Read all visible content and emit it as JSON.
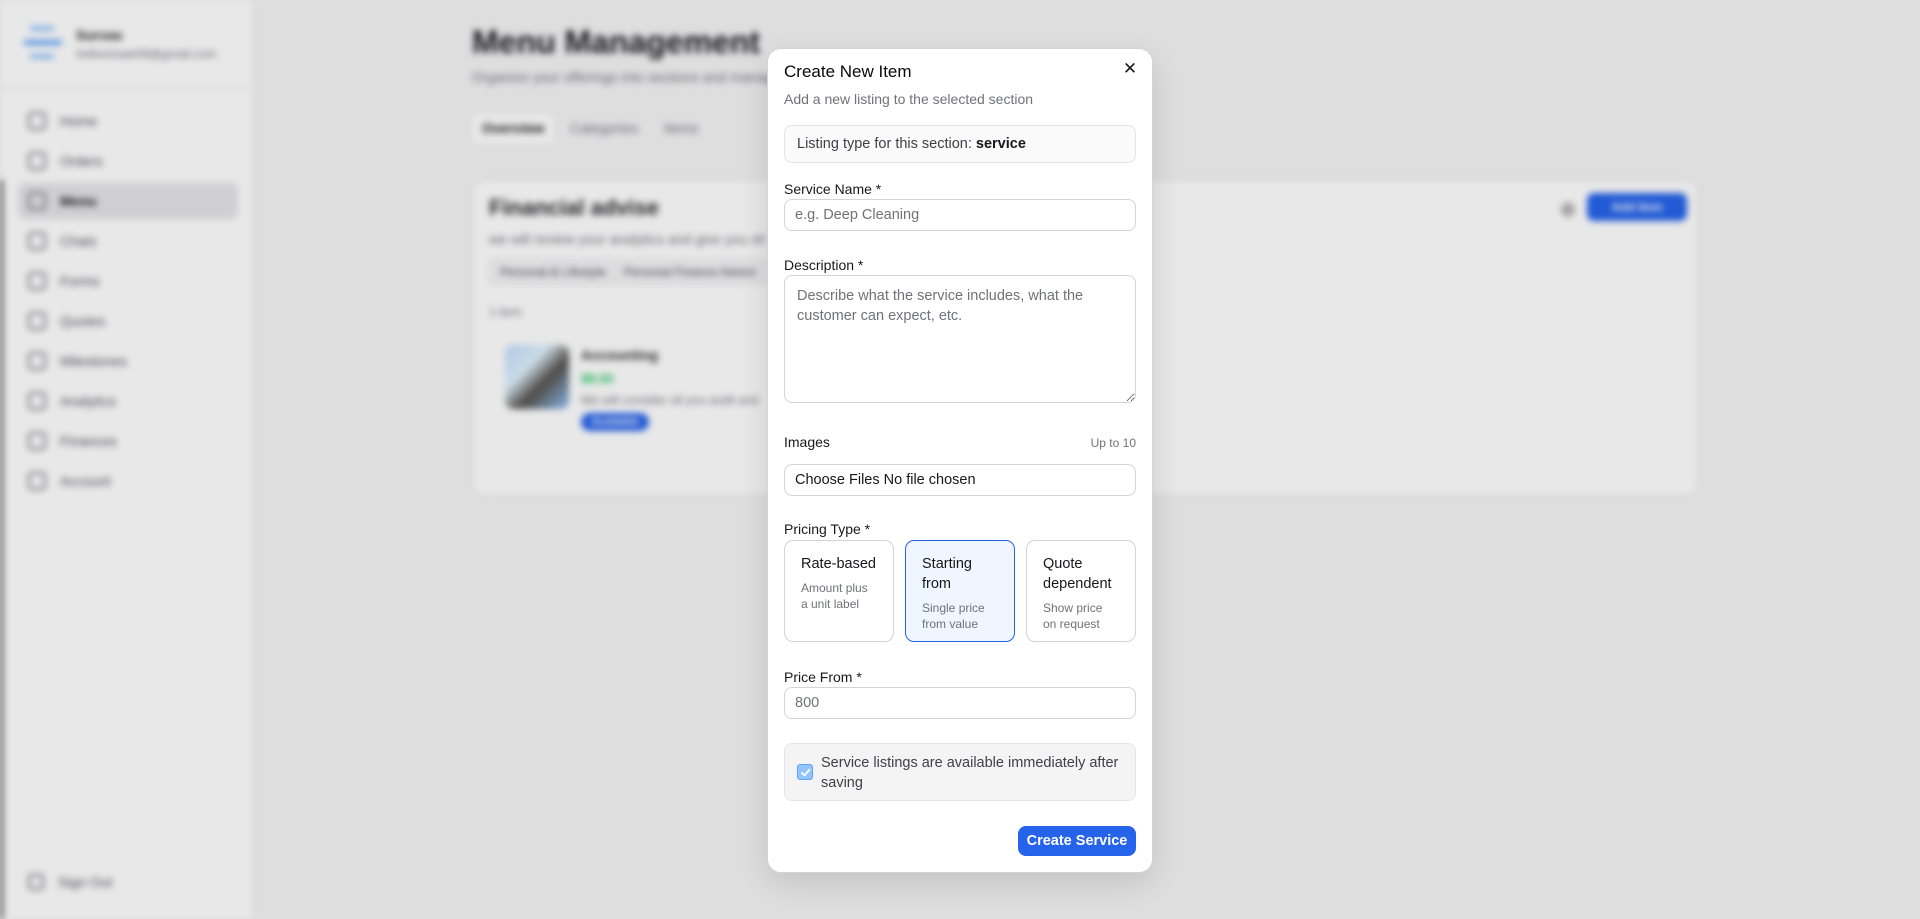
{
  "sidebar": {
    "user_name": "Survas",
    "user_email": "hellosrisaie09@gmail.com",
    "items": [
      {
        "label": "Home",
        "icon": "home-icon"
      },
      {
        "label": "Orders",
        "icon": "orders-icon"
      },
      {
        "label": "Menu",
        "icon": "menu-icon",
        "active": true
      },
      {
        "label": "Chats",
        "icon": "chats-icon"
      },
      {
        "label": "Forms",
        "icon": "forms-icon"
      },
      {
        "label": "Quotes",
        "icon": "quotes-icon"
      },
      {
        "label": "Milestones",
        "icon": "milestones-icon"
      },
      {
        "label": "Analytics",
        "icon": "analytics-icon"
      },
      {
        "label": "Finances",
        "icon": "finances-icon"
      },
      {
        "label": "Account",
        "icon": "account-icon"
      }
    ],
    "signout_label": "Sign Out"
  },
  "page": {
    "title": "Menu Management",
    "subtitle": "Organize your offerings into sections and manage",
    "tabs": [
      {
        "label": "Overview",
        "active": true
      },
      {
        "label": "Categories"
      },
      {
        "label": "Items"
      }
    ]
  },
  "section_card": {
    "title": "Financial advise",
    "description": "we will review your analytics and give you sh",
    "chips": [
      "Personal & Lifestyle",
      "Personal Finance Advice"
    ],
    "count": "1 item",
    "add_button": "Add Item",
    "item": {
      "name": "Accounting",
      "price": "$8.00",
      "description": "We will consider all you audit and",
      "badge": "Available"
    }
  },
  "modal": {
    "title": "Create New Item",
    "subtitle": "Add a new listing to the selected section",
    "listing_type_prefix": "Listing type for this section:",
    "listing_type_value": "service",
    "service_name_label": "Service Name *",
    "service_name_placeholder": "e.g. Deep Cleaning",
    "description_label": "Description *",
    "description_placeholder": "Describe what the service includes, what the customer can expect, etc.",
    "images_label": "Images",
    "images_hint": "Up to 10",
    "file_button": "Choose Files",
    "file_status": "No file chosen",
    "pricing_type_label": "Pricing Type *",
    "pricing_options": [
      {
        "title": "Rate-based",
        "desc": "Amount plus a unit label",
        "selected": false
      },
      {
        "title": "Starting from",
        "desc": "Single price from value",
        "selected": true
      },
      {
        "title": "Quote dependent",
        "desc": "Show price on request",
        "selected": false
      }
    ],
    "price_from_label": "Price From *",
    "price_from_placeholder": "800",
    "availability_notice": "Service listings are available immediately after saving",
    "availability_checked": true,
    "submit_label": "Create Service"
  },
  "colors": {
    "accent": "#2563eb",
    "selected_bg": "#eff6ff",
    "price_green": "#22c55e"
  }
}
